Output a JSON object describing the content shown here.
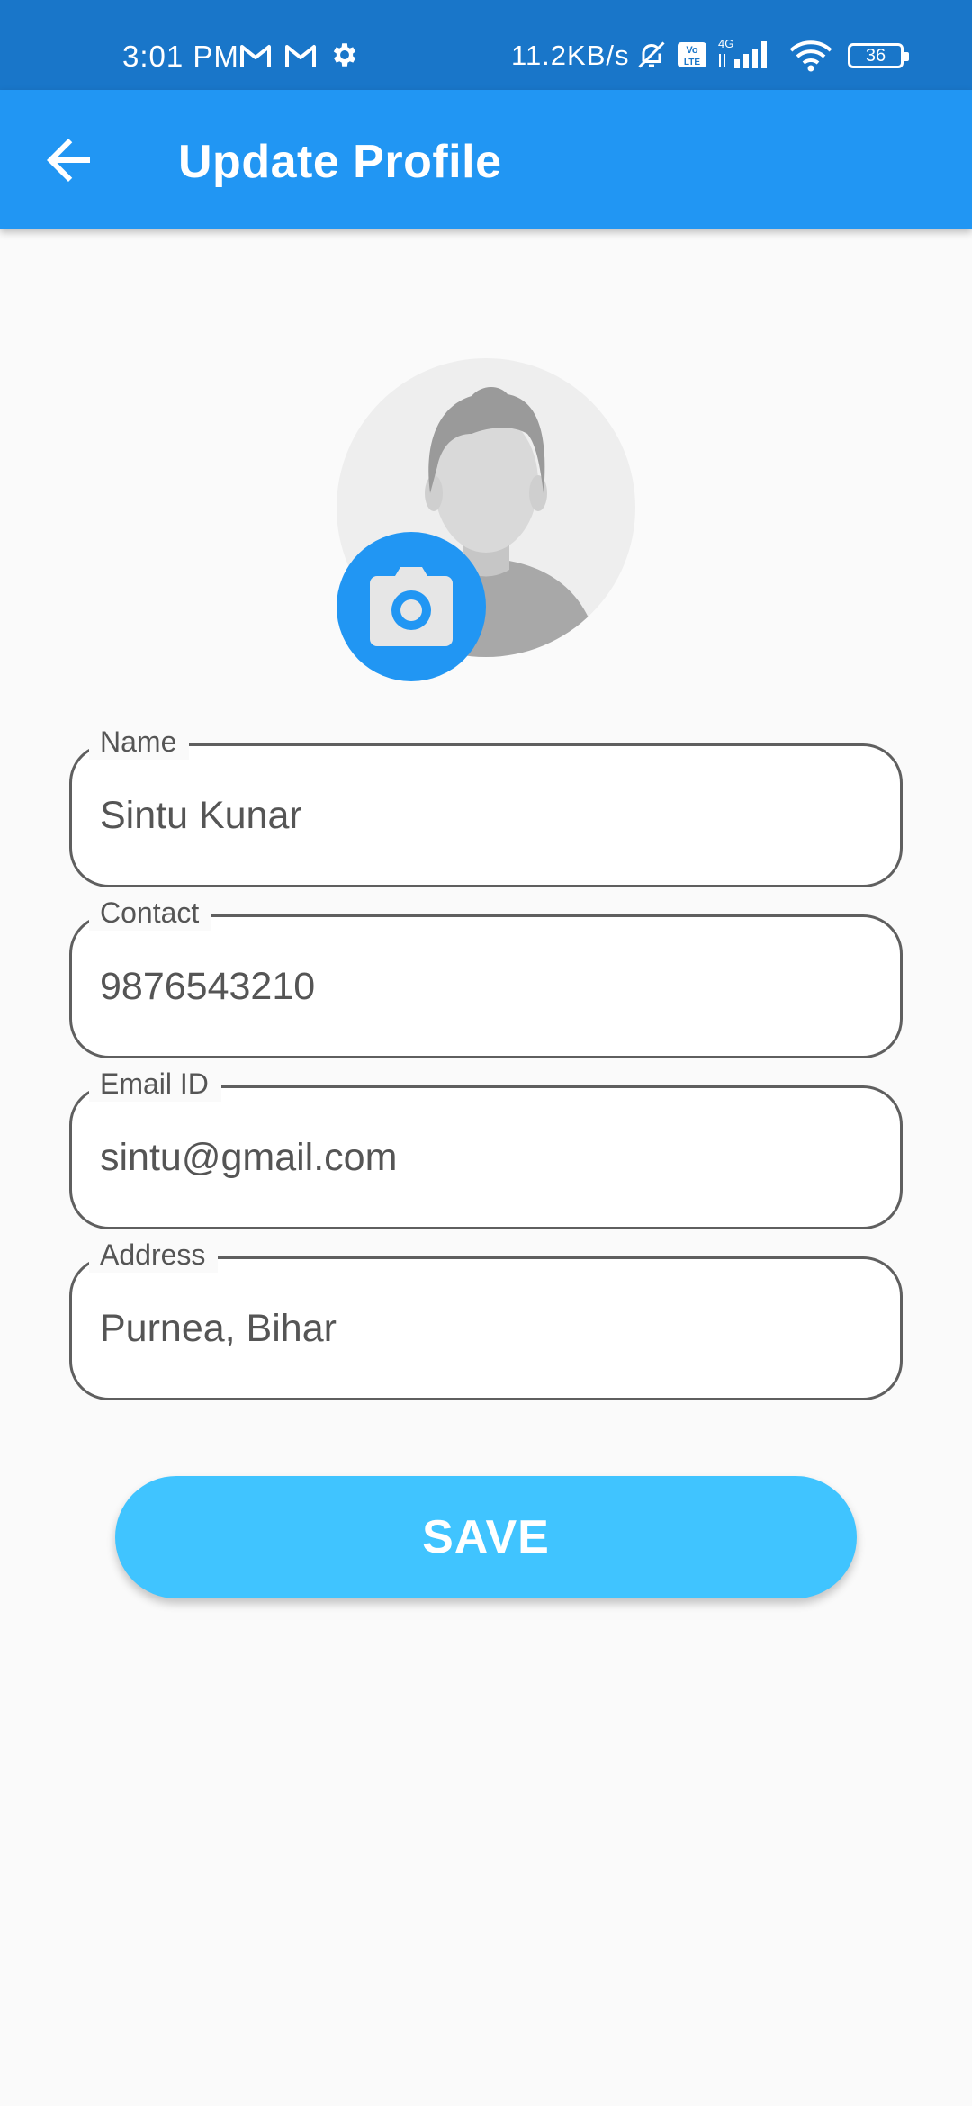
{
  "status_bar": {
    "time": "3:01 PM",
    "network_speed": "11.2KB/s",
    "battery_level": "36",
    "icons": [
      "gmail-icon",
      "gmail-icon",
      "settings-gear-icon",
      "muted-bell-icon",
      "volte-icon",
      "4g-signal-icon",
      "wifi-icon",
      "battery-icon"
    ]
  },
  "app_bar": {
    "title": "Update Profile",
    "back_icon": "arrow-left-icon",
    "background": "#2196f3"
  },
  "avatar": {
    "icon": "default-user-avatar",
    "camera_icon": "camera-icon"
  },
  "form": {
    "fields": [
      {
        "label": "Name",
        "value": "Sintu Kunar"
      },
      {
        "label": "Contact",
        "value": "9876543210"
      },
      {
        "label": "Email ID",
        "value": "sintu@gmail.com"
      },
      {
        "label": "Address",
        "value": "Purnea, Bihar"
      }
    ]
  },
  "save_button": {
    "label": "SAVE",
    "color": "#40c4ff"
  }
}
